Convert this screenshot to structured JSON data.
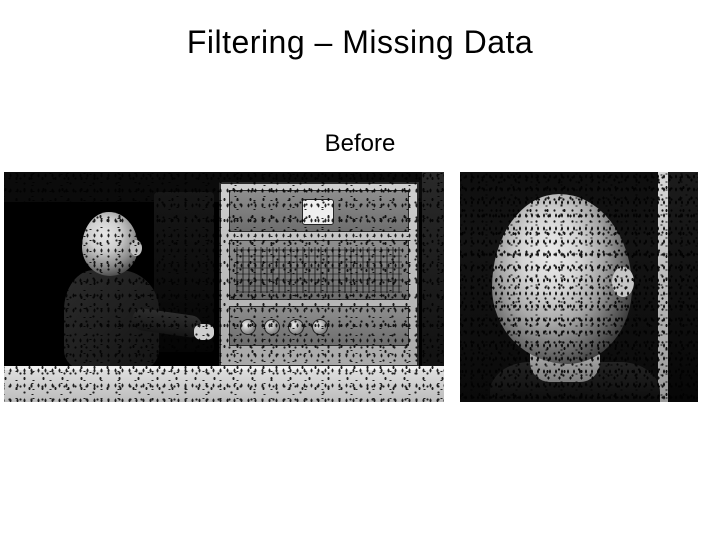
{
  "title": "Filtering – Missing Data",
  "subtitle": "Before",
  "figures": {
    "left": {
      "name": "before-image-full",
      "alt": "Grayscale photograph of a person seated at an equipment rack, corrupted by dense black pepper noise (missing pixels)."
    },
    "right": {
      "name": "before-image-crop",
      "alt": "Close-up crop of the person's head from the same photograph, also corrupted by dense black pepper noise."
    }
  }
}
